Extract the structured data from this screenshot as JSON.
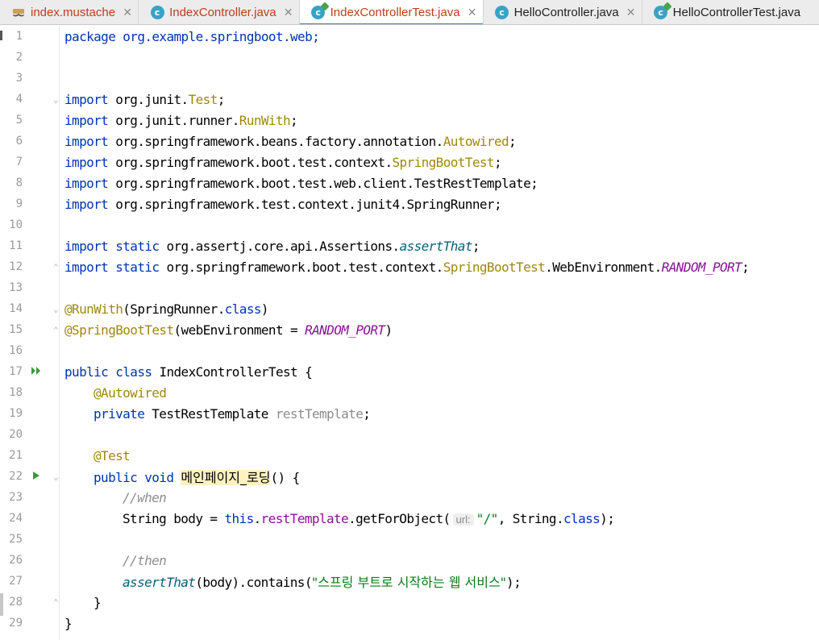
{
  "tabs": [
    {
      "label": "index.mustache",
      "icon": "mustache-icon",
      "modified": true,
      "active": false
    },
    {
      "label": "IndexController.java",
      "icon": "class-icon",
      "modified": true,
      "active": false
    },
    {
      "label": "IndexControllerTest.java",
      "icon": "test-class-icon",
      "modified": true,
      "active": true
    },
    {
      "label": "HelloController.java",
      "icon": "class-icon",
      "modified": false,
      "active": false
    },
    {
      "label": "HelloControllerTest.java",
      "icon": "test-class-icon",
      "modified": false,
      "active": false
    }
  ],
  "close_glyph": "✕",
  "class_icon_letter": "c",
  "editor": {
    "line_numbers": [
      "1",
      "2",
      "3",
      "4",
      "5",
      "6",
      "7",
      "8",
      "9",
      "10",
      "11",
      "12",
      "13",
      "14",
      "15",
      "16",
      "17",
      "18",
      "19",
      "20",
      "21",
      "22",
      "23",
      "24",
      "25",
      "26",
      "27",
      "28",
      "29"
    ],
    "code": {
      "l1": "package org.example.springboot.web;",
      "l4_kw": "import",
      "l4_pkg": " org.junit.",
      "l4_cls": "Test",
      "l4_end": ";",
      "l5_kw": "import",
      "l5_pkg": " org.junit.runner.",
      "l5_cls": "RunWith",
      "l5_end": ";",
      "l6_kw": "import",
      "l6_pkg": " org.springframework.beans.factory.annotation.",
      "l6_cls": "Autowired",
      "l6_end": ";",
      "l7_kw": "import",
      "l7_pkg": " org.springframework.boot.test.context.",
      "l7_cls": "SpringBootTest",
      "l7_end": ";",
      "l8_kw": "import",
      "l8_rest": " org.springframework.boot.test.web.client.TestRestTemplate;",
      "l9_kw": "import",
      "l9_rest": " org.springframework.test.context.junit4.SpringRunner;",
      "l11_kw": "import static",
      "l11_pkg": " org.assertj.core.api.Assertions.",
      "l11_m": "assertThat",
      "l11_end": ";",
      "l12_kw": "import static",
      "l12_pkg": " org.springframework.boot.test.context.",
      "l12_cls": "SpringBootTest",
      "l12_mid": ".WebEnvironment.",
      "l12_const": "RANDOM_PORT",
      "l12_end": ";",
      "l14_ann": "@RunWith",
      "l14_mid": "(SpringRunner.",
      "l14_kw": "class",
      "l14_end": ")",
      "l15_ann": "@SpringBootTest",
      "l15_mid": "(webEnvironment = ",
      "l15_const": "RANDOM_PORT",
      "l15_end": ")",
      "l17_kw": "public class",
      "l17_rest": " IndexControllerTest {",
      "l18_ann": "@Autowired",
      "l19_kw": "private",
      "l19_type": " TestRestTemplate ",
      "l19_field": "restTemplate",
      "l19_end": ";",
      "l21_ann": "@Test",
      "l22_kw": "public void",
      "l22_sp": " ",
      "l22_name": "메인페이지_로딩",
      "l22_end": "() {",
      "l23_comment": "//when",
      "l24_a": "String body = ",
      "l24_kw": "this",
      "l24_dot": ".",
      "l24_field": "restTemplate",
      "l24_b": ".getForObject(",
      "l24_hint": "url:",
      "l24_str": "\"/\"",
      "l24_c": ", String.",
      "l24_kw2": "class",
      "l24_end": ");",
      "l26_comment": "//then",
      "l27_m": "assertThat",
      "l27_a": "(body).contains(",
      "l27_str": "\"스프링 부트로 시작하는 웹 서비스\"",
      "l27_end": ");",
      "l28": "}",
      "l29": "}"
    }
  }
}
